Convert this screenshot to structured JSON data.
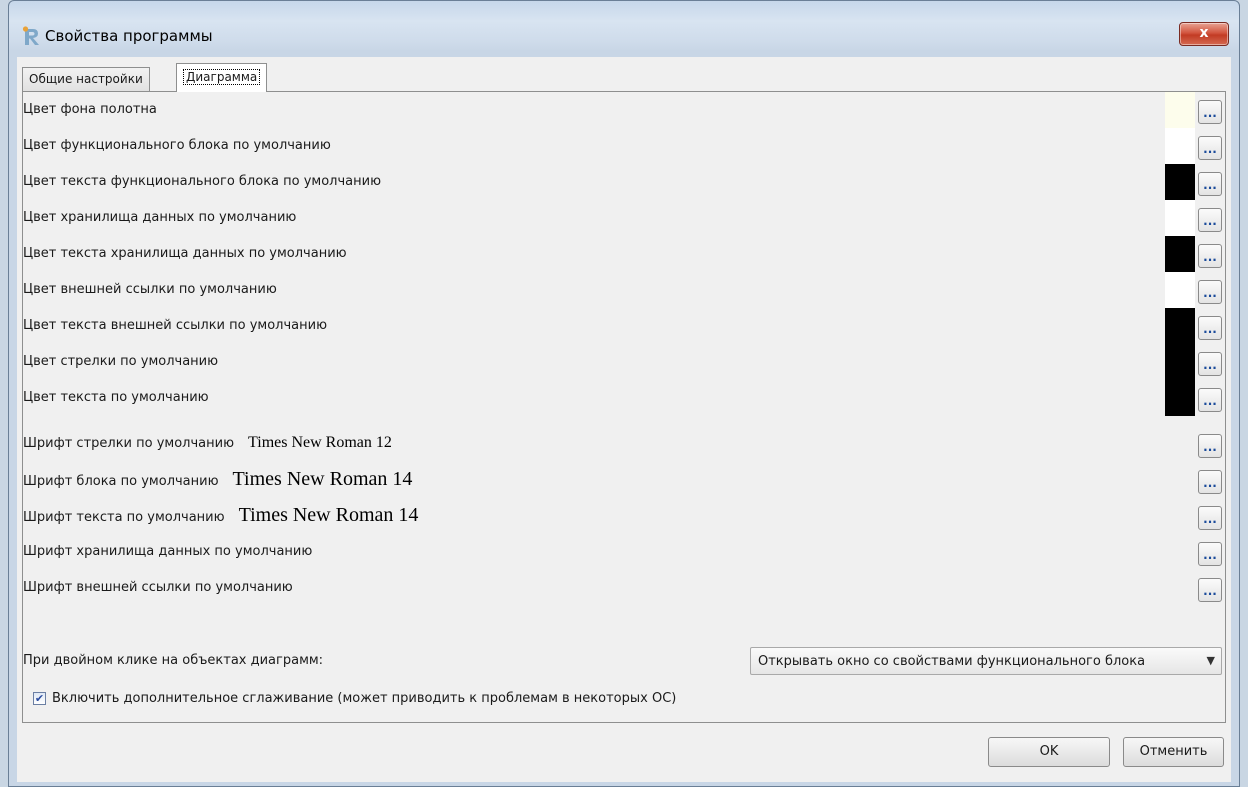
{
  "window": {
    "title": "Свойства программы",
    "close_label": "x"
  },
  "tabs": [
    {
      "label": "Общие настройки",
      "active": false
    },
    {
      "label": "Диаграмма",
      "active": true
    }
  ],
  "color_settings": [
    {
      "label": "Цвет фона полотна",
      "color": "#fdfdec",
      "button": "..."
    },
    {
      "label": "Цвет функционального блока по умолчанию",
      "color": "#ffffff",
      "button": "..."
    },
    {
      "label": "Цвет текста функционального блока по умолчанию",
      "color": "#000000",
      "button": "..."
    },
    {
      "label": "Цвет хранилища данных по умолчанию",
      "color": "#ffffff",
      "button": "..."
    },
    {
      "label": "Цвет текста хранилища данных по умолчанию",
      "color": "#000000",
      "button": "..."
    },
    {
      "label": "Цвет внешней ссылки по умолчанию",
      "color": "#ffffff",
      "button": "..."
    },
    {
      "label": "Цвет текста внешней ссылки по умолчанию",
      "color": "#000000",
      "button": "..."
    },
    {
      "label": "Цвет стрелки по умолчанию",
      "color": "#000000",
      "button": "..."
    },
    {
      "label": "Цвет текста по умолчанию",
      "color": "#000000",
      "button": "..."
    }
  ],
  "font_settings": [
    {
      "label": "Шрифт стрелки по умолчанию",
      "sample": "Times New Roman 12",
      "button": "..."
    },
    {
      "label": "Шрифт блока по умолчанию",
      "sample": "Times New Roman 14",
      "button": "..."
    },
    {
      "label": "Шрифт текста по умолчанию",
      "sample": "Times New Roman 14",
      "button": "..."
    },
    {
      "label": "Шрифт хранилища данных по умолчанию",
      "sample": "",
      "button": "..."
    },
    {
      "label": "Шрифт внешней ссылки по умолчанию",
      "sample": "",
      "button": "..."
    }
  ],
  "double_click": {
    "label": "При двойном клике на объектах диаграмм:",
    "selected": "Открывать окно со свойствами функционального блока"
  },
  "smoothing": {
    "label": "Включить дополнительное сглаживание (может приводить к проблемам в некоторых ОС)",
    "checked": true
  },
  "buttons": {
    "ok": "OK",
    "cancel": "Отменить"
  }
}
